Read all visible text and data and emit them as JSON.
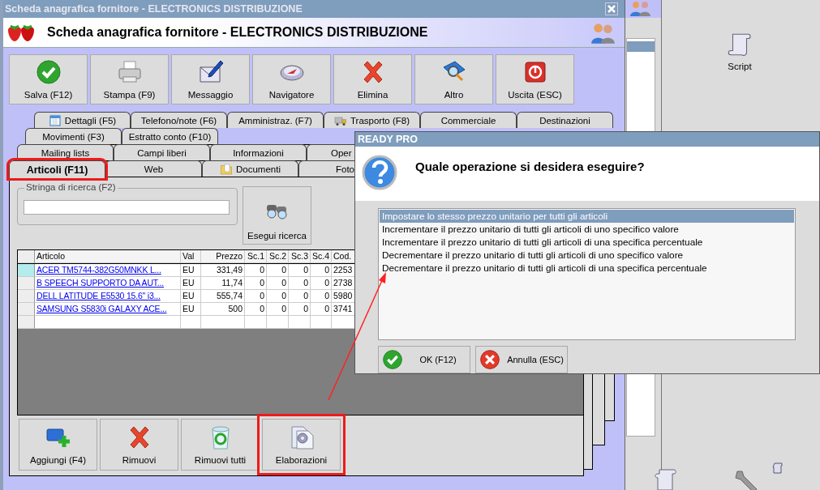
{
  "window": {
    "title": "Scheda anagrafica fornitore - ELECTRONICS DISTRIBUZIONE",
    "heading": "Scheda anagrafica fornitore - ELECTRONICS DISTRIBUZIONE"
  },
  "toolbar": [
    {
      "label": "Salva (F12)"
    },
    {
      "label": "Stampa (F9)"
    },
    {
      "label": "Messaggio"
    },
    {
      "label": "Navigatore"
    },
    {
      "label": "Elimina"
    },
    {
      "label": "Altro"
    },
    {
      "label": "Uscita (ESC)"
    }
  ],
  "tab_rows": [
    [
      {
        "label": "Dettagli (F5)",
        "selected": false
      },
      {
        "label": "Telefono/note (F6)",
        "selected": false
      },
      {
        "label": "Amministraz. (F7)",
        "selected": false
      },
      {
        "label": "Trasporto (F8)",
        "selected": false
      },
      {
        "label": "Commerciale",
        "selected": false
      },
      {
        "label": "Destinazioni",
        "selected": false
      }
    ],
    [
      {
        "label": "Movimenti (F3)",
        "selected": false
      },
      {
        "label": "Estratto conto (F10)",
        "selected": false
      }
    ],
    [
      {
        "label": "Mailing lists",
        "selected": false
      },
      {
        "label": "Campi liberi",
        "selected": false
      },
      {
        "label": "Informazioni",
        "selected": false
      },
      {
        "label": "Oper",
        "selected": false
      }
    ],
    [
      {
        "label": "Articoli (F11)",
        "selected": true,
        "highlighted": true
      },
      {
        "label": "Web",
        "selected": false
      },
      {
        "label": "Documenti",
        "selected": false
      },
      {
        "label": "Foto",
        "selected": false
      }
    ]
  ],
  "search": {
    "label": "Stringa di ricerca (F2)",
    "button": "Esegui ricerca"
  },
  "table": {
    "columns": [
      "Articolo",
      "Val",
      "Prezzo",
      "Sc.1",
      "Sc.2",
      "Sc.3",
      "Sc.4",
      "Cod."
    ],
    "rows": [
      {
        "selected": true,
        "cells": [
          "ACER TM5744-382G50MNKK L...",
          "EU",
          "331,49",
          "0",
          "0",
          "0",
          "0",
          "2253"
        ]
      },
      {
        "selected": false,
        "cells": [
          "B SPEECH SUPPORTO DA AUT...",
          "EU",
          "11,74",
          "0",
          "0",
          "0",
          "0",
          "2738"
        ]
      },
      {
        "selected": false,
        "cells": [
          "DELL LATITUDE E5530 15.6\" i3...",
          "EU",
          "555,74",
          "0",
          "0",
          "0",
          "0",
          "5980"
        ]
      },
      {
        "selected": false,
        "cells": [
          "SAMSUNG S5830i GALAXY ACE...",
          "EU",
          "500",
          "0",
          "0",
          "0",
          "0",
          "3741"
        ]
      }
    ]
  },
  "bottom_buttons": [
    {
      "label": "Aggiungi (F4)",
      "highlighted": false
    },
    {
      "label": "Rimuovi",
      "highlighted": false
    },
    {
      "label": "Rimuovi tutti",
      "highlighted": false
    },
    {
      "label": "Elaborazioni",
      "highlighted": true
    }
  ],
  "dialog": {
    "title": "READY PRO",
    "question": "Quale operazione si desidera eseguire?",
    "options": [
      {
        "label": "Impostare lo stesso prezzo unitario per tutti gli articoli",
        "selected": true
      },
      {
        "label": "Incrementare il prezzo unitario di tutti gli articoli di uno specifico valore",
        "selected": false
      },
      {
        "label": "Incrementare il prezzo unitario di tutti gli articoli di una specifica percentuale",
        "selected": false
      },
      {
        "label": "Decrementare il prezzo unitario di tutti gli articoli di uno specifico valore",
        "selected": false
      },
      {
        "label": "Decrementare il prezzo unitario di tutti gli articoli di una specifica percentuale",
        "selected": false
      }
    ],
    "buttons": [
      {
        "label": "OK (F12)"
      },
      {
        "label": "Annulla (ESC)"
      }
    ]
  },
  "desktop": {
    "icons": [
      {
        "label": "Script"
      }
    ]
  }
}
